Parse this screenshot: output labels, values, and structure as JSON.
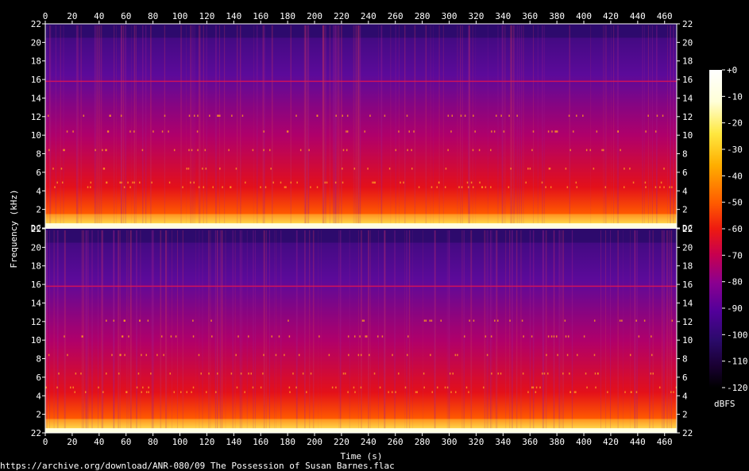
{
  "chart_data": {
    "type": "heatmap",
    "title": "",
    "xlabel": "Time (s)",
    "ylabel": "Frequency (kHz)",
    "x_ticks": [
      "0",
      "20",
      "40",
      "60",
      "80",
      "100",
      "120",
      "140",
      "160",
      "180",
      "200",
      "220",
      "240",
      "260",
      "280",
      "300",
      "320",
      "340",
      "360",
      "380",
      "400",
      "420",
      "440",
      "460"
    ],
    "xlim": [
      0,
      469
    ],
    "channels": [
      {
        "name": "",
        "y_ticks": [
          "DC",
          "2",
          "4",
          "6",
          "8",
          "10",
          "12",
          "14",
          "16",
          "18",
          "20",
          "22"
        ],
        "ylim": [
          0,
          22
        ]
      },
      {
        "name": "",
        "y_ticks": [
          "22",
          "2",
          "4",
          "6",
          "8",
          "10",
          "12",
          "14",
          "16",
          "18",
          "20",
          "22"
        ],
        "ylim": [
          0,
          22
        ]
      }
    ],
    "colorbar": {
      "label": "dBFS",
      "ticks": [
        "+0",
        "-10",
        "-20",
        "-30",
        "-40",
        "-50",
        "-60",
        "-70",
        "-80",
        "-90",
        "-100",
        "-110",
        "-120"
      ],
      "range": [
        -120,
        0
      ],
      "colors": [
        "#000000",
        "#1a0033",
        "#2b0a6b",
        "#52009a",
        "#8b0090",
        "#c8004e",
        "#ee1a10",
        "#ff5a00",
        "#ffae00",
        "#ffe840",
        "#ffffd8",
        "#ffffff"
      ]
    },
    "lowpass_khz": 20.5,
    "hum_line_khz": 15.8,
    "grid": false
  },
  "footer": {
    "source_path": "https://archive.org/download/ANR-080/09 The Possession of Susan Barnes.flac"
  }
}
